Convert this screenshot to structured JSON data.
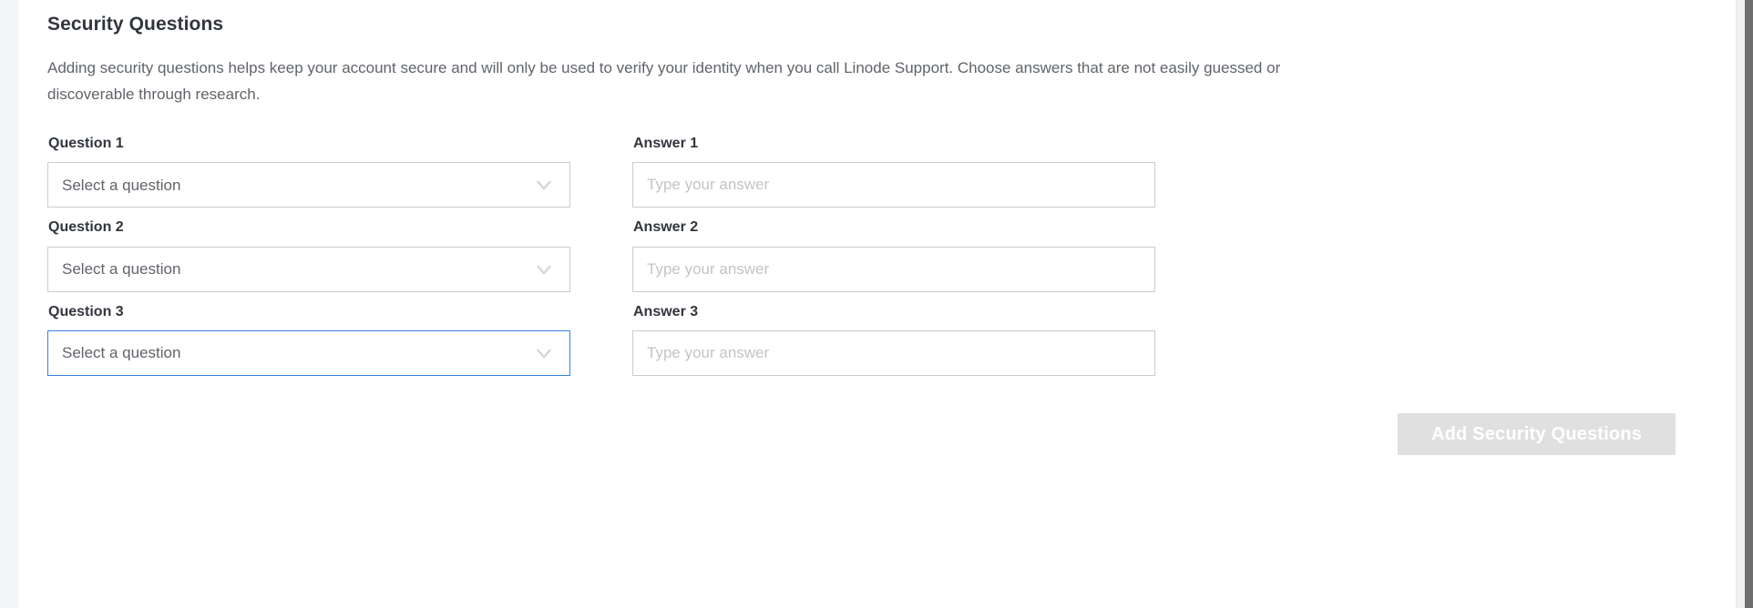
{
  "panel": {
    "title": "Security Questions",
    "description": "Adding security questions helps keep your account secure and will only be used to verify your identity when you call Linode Support. Choose answers that are not easily guessed or discoverable through research."
  },
  "form": {
    "rows": [
      {
        "question_label": "Question 1",
        "question_value": "Select a question",
        "question_focused": false,
        "answer_label": "Answer 1",
        "answer_value": "",
        "answer_placeholder": "Type your answer"
      },
      {
        "question_label": "Question 2",
        "question_value": "Select a question",
        "question_focused": false,
        "answer_label": "Answer 2",
        "answer_value": "",
        "answer_placeholder": "Type your answer"
      },
      {
        "question_label": "Question 3",
        "question_value": "Select a question",
        "question_focused": true,
        "answer_label": "Answer 3",
        "answer_value": "",
        "answer_placeholder": "Type your answer"
      }
    ],
    "dropdown_icon": "chevron-down-icon"
  },
  "actions": {
    "submit_label": "Add Security Questions",
    "submit_disabled": true
  },
  "colors": {
    "focus_border": "#3683dc",
    "field_border": "#cccccc",
    "heading_text": "#32363c",
    "body_text": "#606469",
    "placeholder_text": "#c2c4c6",
    "disabled_button_bg": "#e0e0e0",
    "disabled_button_text": "#ffffff",
    "gutter_bg": "#f4f5f7",
    "scrollbar_track": "#f1f1f1",
    "scrollbar_thumb": "#6e6e6e"
  }
}
